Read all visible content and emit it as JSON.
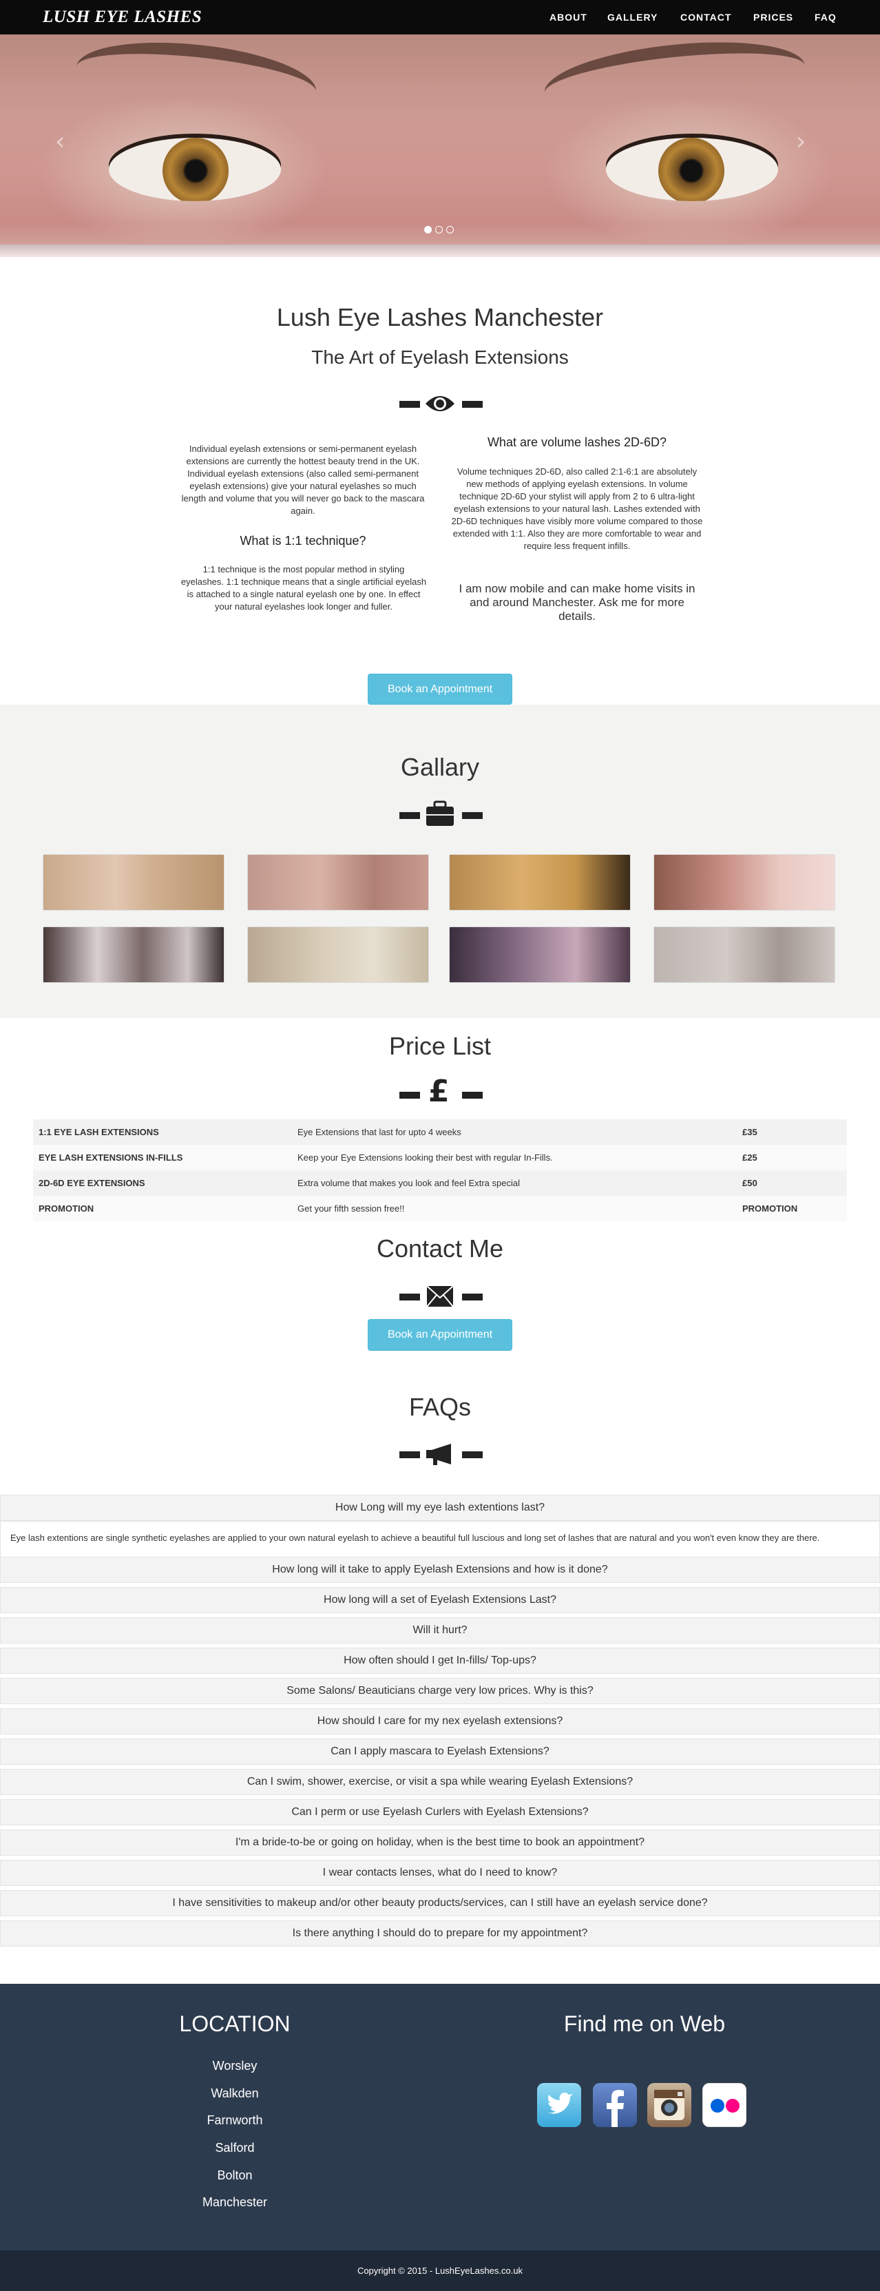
{
  "nav": {
    "brand": "LUSH EYE LASHES",
    "links": [
      "ABOUT",
      "GALLERY",
      "CONTACT",
      "PRICES",
      "FAQ"
    ]
  },
  "hero": {
    "prev": "‹",
    "next": "›",
    "slides": 3,
    "active_slide": 1
  },
  "about": {
    "title": "Lush Eye Lashes Manchester",
    "subtitle": "The Art of Eyelash Extensions",
    "left_intro": "Individual eyelash extensions or semi-permanent eyelash extensions are currently the hottest beauty trend in the UK. Individual eyelash extensions (also called semi-permanent eyelash extensions) give your natural eyelashes so much length and volume that you will never go back to the mascara again.",
    "left_heading": "What is 1:1 technique?",
    "left_body": "1:1 technique is the most popular method in styling eyelashes. 1:1 technique means that a single artificial eyelash is attached to a single natural eyelash one by one. In effect your natural eyelashes look longer and fuller.",
    "right_heading": "What are volume lashes 2D-6D?",
    "right_body": "Volume techniques 2D-6D, also called 2:1-6:1 are absolutely new methods of applying eyelash extensions. In volume technique 2D-6D your stylist will apply from 2 to 6 ultra-light eyelash extensions to your natural lash. Lashes extended with 2D-6D techniques have visibly more volume compared to those extended with 1:1. Also they are more comfortable to wear and require less frequent infills.",
    "right_mobile": "I am now mobile and can make home visits in and around Manchester. Ask me for more details.",
    "book_button": "Book an Appointment"
  },
  "gallery": {
    "title": "Gallary"
  },
  "prices": {
    "title": "Price List",
    "rows": [
      {
        "name": "1:1 EYE LASH EXTENSIONS",
        "desc": "Eye Extensions that last for upto 4 weeks",
        "price": "£35"
      },
      {
        "name": "EYE LASH EXTENSIONS IN-FILLS",
        "desc": "Keep your Eye Extensions looking their best with regular In-Fills.",
        "price": "£25"
      },
      {
        "name": "2D-6D EYE EXTENSIONS",
        "desc": "Extra volume that makes you look and feel Extra special",
        "price": "£50"
      },
      {
        "name": "PROMOTION",
        "desc": "Get your fifth session free!!",
        "price": "PROMOTION"
      }
    ]
  },
  "contact": {
    "title": "Contact Me",
    "book_button": "Book an Appointment"
  },
  "faq": {
    "title": "FAQs",
    "questions": [
      "How Long will my eye lash extentions last?",
      "How long will it take to apply Eyelash Extensions and how is it done?",
      "How long will a set of Eyelash Extensions Last?",
      "Will it hurt?",
      "How often should I get In-fills/ Top-ups?",
      "Some Salons/ Beauticians charge very low prices. Why is this?",
      "How should I care for my nex eyelash extensions?",
      "Can I apply mascara to Eyelash Extensions?",
      "Can I swim, shower, exercise, or visit a spa while wearing Eyelash Extensions?",
      "Can I perm or use Eyelash Curlers with Eyelash Extensions?",
      "I'm a bride-to-be or going on holiday, when is the best time to book an appointment?",
      "I wear contacts lenses, what do I need to know?",
      "I have sensitivities to makeup and/or other beauty products/services, can I still have an eyelash service done?",
      "Is there anything I should do to prepare for my appointment?"
    ],
    "open_answer": "Eye lash extentions are single synthetic eyelashes are applied to your own natural eyelash to achieve a beautiful full luscious and long set of lashes that are natural and you won't even know they are there."
  },
  "footer": {
    "location_title": "LOCATION",
    "locations": [
      "Worsley",
      "Walkden",
      "Farnworth",
      "Salford",
      "Bolton",
      "Manchester"
    ],
    "web_title": "Find me on Web",
    "copyright": "Copyright © 2015 - LushEyeLashes.co.uk"
  },
  "colors": {
    "accent": "#5bc0de",
    "footer": "#2d3b4e",
    "navbar": "#0b0b0b"
  }
}
